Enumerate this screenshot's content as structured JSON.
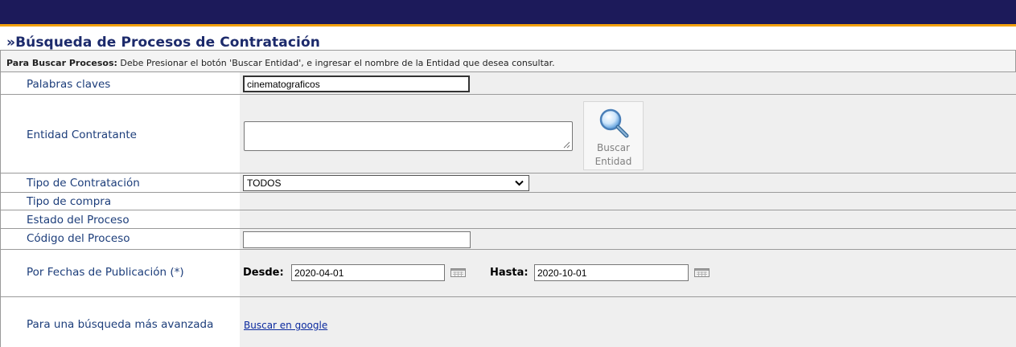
{
  "page": {
    "title": "»Búsqueda de Procesos de Contratación"
  },
  "instructions": {
    "bold": "Para Buscar Procesos:",
    "text": " Debe Presionar el botón 'Buscar Entidad', e ingresar el nombre de la Entidad que desea consultar."
  },
  "fields": {
    "keywords_label": "Palabras claves",
    "keywords_value": "cinematograficos",
    "entity_label": "Entidad Contratante",
    "entity_value": "",
    "search_entity_line1": "Buscar",
    "search_entity_line2": "Entidad",
    "contract_type_label": "Tipo de Contratación",
    "contract_type_value": "TODOS",
    "purchase_type_label": "Tipo de compra",
    "process_state_label": "Estado del Proceso",
    "process_code_label": "Código del Proceso",
    "process_code_value": "",
    "dates_label": "Por Fechas de Publicación (*)",
    "from_label": "Desde:",
    "from_value": "2020-04-01",
    "to_label": "Hasta:",
    "to_value": "2020-10-01",
    "advanced_label": "Para una búsqueda más avanzada",
    "advanced_link": "Buscar en google"
  },
  "icons": {
    "search_entity": "magnifier-icon",
    "calendar": "calendar-icon"
  },
  "colors": {
    "header_bg": "#1c1a5a",
    "header_accent": "#f2a10c",
    "title": "#1c2a6b",
    "label": "#1c3d7a",
    "value_bg": "#efefef"
  }
}
